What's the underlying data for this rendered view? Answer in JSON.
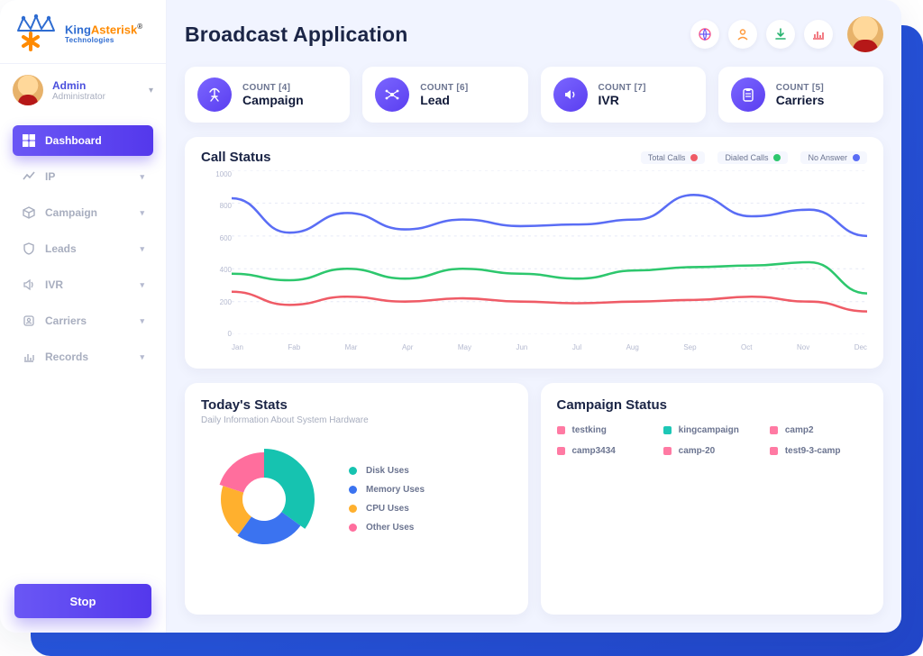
{
  "brand": {
    "name1": "King",
    "name2": "Asterisk",
    "sub": "Technologies"
  },
  "user": {
    "name": "Admin",
    "role": "Administrator"
  },
  "nav": {
    "items": [
      {
        "label": "Dashboard",
        "active": true
      },
      {
        "label": "IP",
        "active": false
      },
      {
        "label": "Campaign",
        "active": false
      },
      {
        "label": "Leads",
        "active": false
      },
      {
        "label": "IVR",
        "active": false
      },
      {
        "label": "Carriers",
        "active": false
      },
      {
        "label": "Records",
        "active": false
      }
    ],
    "stop": "Stop"
  },
  "header": {
    "title": "Broadcast Application"
  },
  "cards": [
    {
      "count": "COUNT [4]",
      "label": "Campaign"
    },
    {
      "count": "COUNT [6]",
      "label": "Lead"
    },
    {
      "count": "COUNT [7]",
      "label": "IVR"
    },
    {
      "count": "COUNT [5]",
      "label": "Carriers"
    }
  ],
  "callStatus": {
    "title": "Call Status",
    "legend": [
      {
        "label": "Total Calls",
        "color": "#ef5b66"
      },
      {
        "label": "Dialed Calls",
        "color": "#2dc76d"
      },
      {
        "label": "No Answer",
        "color": "#5a6df5"
      }
    ]
  },
  "todays": {
    "title": "Today's Stats",
    "sub": "Daily Information About System Hardware",
    "legend": [
      {
        "label": "Disk Uses",
        "color": "#16c3b0"
      },
      {
        "label": "Memory Uses",
        "color": "#3b73f0"
      },
      {
        "label": "CPU Uses",
        "color": "#ffb02e"
      },
      {
        "label": "Other Uses",
        "color": "#ff6e9d"
      }
    ]
  },
  "campaignStatus": {
    "title": "Campaign Status",
    "items": [
      {
        "label": "testking",
        "color": "#ff7aa3"
      },
      {
        "label": "kingcampaign",
        "color": "#1dc7b6"
      },
      {
        "label": "camp2",
        "color": "#ff7aa3"
      },
      {
        "label": "camp3434",
        "color": "#ff7aa3"
      },
      {
        "label": "camp-20",
        "color": "#ff7aa3"
      },
      {
        "label": "test9-3-camp",
        "color": "#ff7aa3"
      }
    ]
  },
  "chart_data": {
    "type": "line",
    "title": "Call Status",
    "xlabel": "",
    "ylabel": "",
    "ylim": [
      0,
      1000
    ],
    "yticks": [
      0,
      200,
      400,
      600,
      800,
      1000
    ],
    "categories": [
      "Jan",
      "Fab",
      "Mar",
      "Apr",
      "May",
      "Jun",
      "Jul",
      "Aug",
      "Sep",
      "Oct",
      "Nov",
      "Dec"
    ],
    "series": [
      {
        "name": "Total Calls",
        "color": "#ef5b66",
        "values": [
          260,
          180,
          230,
          200,
          220,
          200,
          190,
          200,
          210,
          230,
          200,
          140
        ]
      },
      {
        "name": "Dialed Calls",
        "color": "#2dc76d",
        "values": [
          370,
          330,
          400,
          340,
          400,
          370,
          340,
          390,
          410,
          420,
          440,
          250
        ]
      },
      {
        "name": "No Answer",
        "color": "#5a6df5",
        "values": [
          830,
          620,
          740,
          640,
          700,
          660,
          670,
          700,
          850,
          720,
          760,
          600
        ]
      }
    ],
    "donut": {
      "type": "pie",
      "title": "Today's Stats",
      "series": [
        {
          "name": "Disk Uses",
          "value": 35,
          "color": "#16c3b0"
        },
        {
          "name": "Memory Uses",
          "value": 25,
          "color": "#3b73f0"
        },
        {
          "name": "CPU Uses",
          "value": 20,
          "color": "#ffb02e"
        },
        {
          "name": "Other Uses",
          "value": 20,
          "color": "#ff6e9d"
        }
      ]
    }
  }
}
